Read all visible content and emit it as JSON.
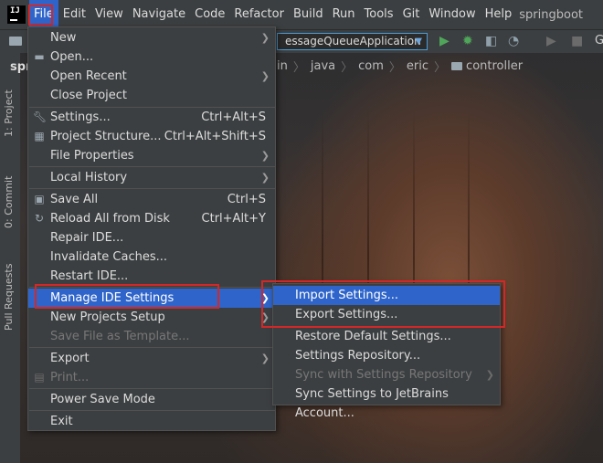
{
  "menubar": {
    "logo": "IJ",
    "items": [
      "File",
      "Edit",
      "View",
      "Navigate",
      "Code",
      "Refactor",
      "Build",
      "Run",
      "Tools",
      "Git",
      "Window",
      "Help"
    ],
    "project_title": "springboot"
  },
  "toolbar": {
    "run_config": "essageQueueApplication",
    "right_label": "G"
  },
  "breadcrumb": [
    "in",
    "java",
    "com",
    "eric",
    "controller"
  ],
  "left_strip": {
    "project_tab_label": "spr",
    "tabs": [
      "1: Project",
      "0: Commit",
      "Pull Requests"
    ]
  },
  "file_menu": {
    "items": [
      {
        "label": "New",
        "shortcut": "",
        "submenu": true,
        "icon": ""
      },
      {
        "label": "Open...",
        "shortcut": "",
        "submenu": false,
        "icon": "folder-icon"
      },
      {
        "label": "Open Recent",
        "shortcut": "",
        "submenu": true,
        "icon": ""
      },
      {
        "label": "Close Project",
        "shortcut": "",
        "submenu": false,
        "icon": ""
      },
      {
        "label": "Settings...",
        "shortcut": "Ctrl+Alt+S",
        "submenu": false,
        "icon": "wrench-icon"
      },
      {
        "label": "Project Structure...",
        "shortcut": "Ctrl+Alt+Shift+S",
        "submenu": false,
        "icon": "project-structure-icon"
      },
      {
        "label": "File Properties",
        "shortcut": "",
        "submenu": true,
        "icon": ""
      },
      {
        "label": "Local History",
        "shortcut": "",
        "submenu": true,
        "icon": ""
      },
      {
        "label": "Save All",
        "shortcut": "Ctrl+S",
        "submenu": false,
        "icon": "save-icon"
      },
      {
        "label": "Reload All from Disk",
        "shortcut": "Ctrl+Alt+Y",
        "submenu": false,
        "icon": "reload-icon"
      },
      {
        "label": "Repair IDE...",
        "shortcut": "",
        "submenu": false,
        "icon": ""
      },
      {
        "label": "Invalidate Caches...",
        "shortcut": "",
        "submenu": false,
        "icon": ""
      },
      {
        "label": "Restart IDE...",
        "shortcut": "",
        "submenu": false,
        "icon": ""
      },
      {
        "label": "Manage IDE Settings",
        "shortcut": "",
        "submenu": true,
        "icon": ""
      },
      {
        "label": "New Projects Setup",
        "shortcut": "",
        "submenu": true,
        "icon": ""
      },
      {
        "label": "Save File as Template...",
        "shortcut": "",
        "submenu": false,
        "icon": ""
      },
      {
        "label": "Export",
        "shortcut": "",
        "submenu": true,
        "icon": ""
      },
      {
        "label": "Print...",
        "shortcut": "",
        "submenu": false,
        "icon": "print-icon"
      },
      {
        "label": "Power Save Mode",
        "shortcut": "",
        "submenu": false,
        "icon": ""
      },
      {
        "label": "Exit",
        "shortcut": "",
        "submenu": false,
        "icon": ""
      }
    ]
  },
  "submenu": {
    "items": [
      {
        "label": "Import Settings..."
      },
      {
        "label": "Export Settings..."
      },
      {
        "label": "Restore Default Settings..."
      },
      {
        "label": "Settings Repository..."
      },
      {
        "label": "Sync with Settings Repository"
      },
      {
        "label": "Sync Settings to JetBrains Account..."
      }
    ]
  },
  "colors": {
    "selection": "#2f65ca",
    "highlight_box": "#d42727",
    "menu_bg": "#3c3f41"
  }
}
